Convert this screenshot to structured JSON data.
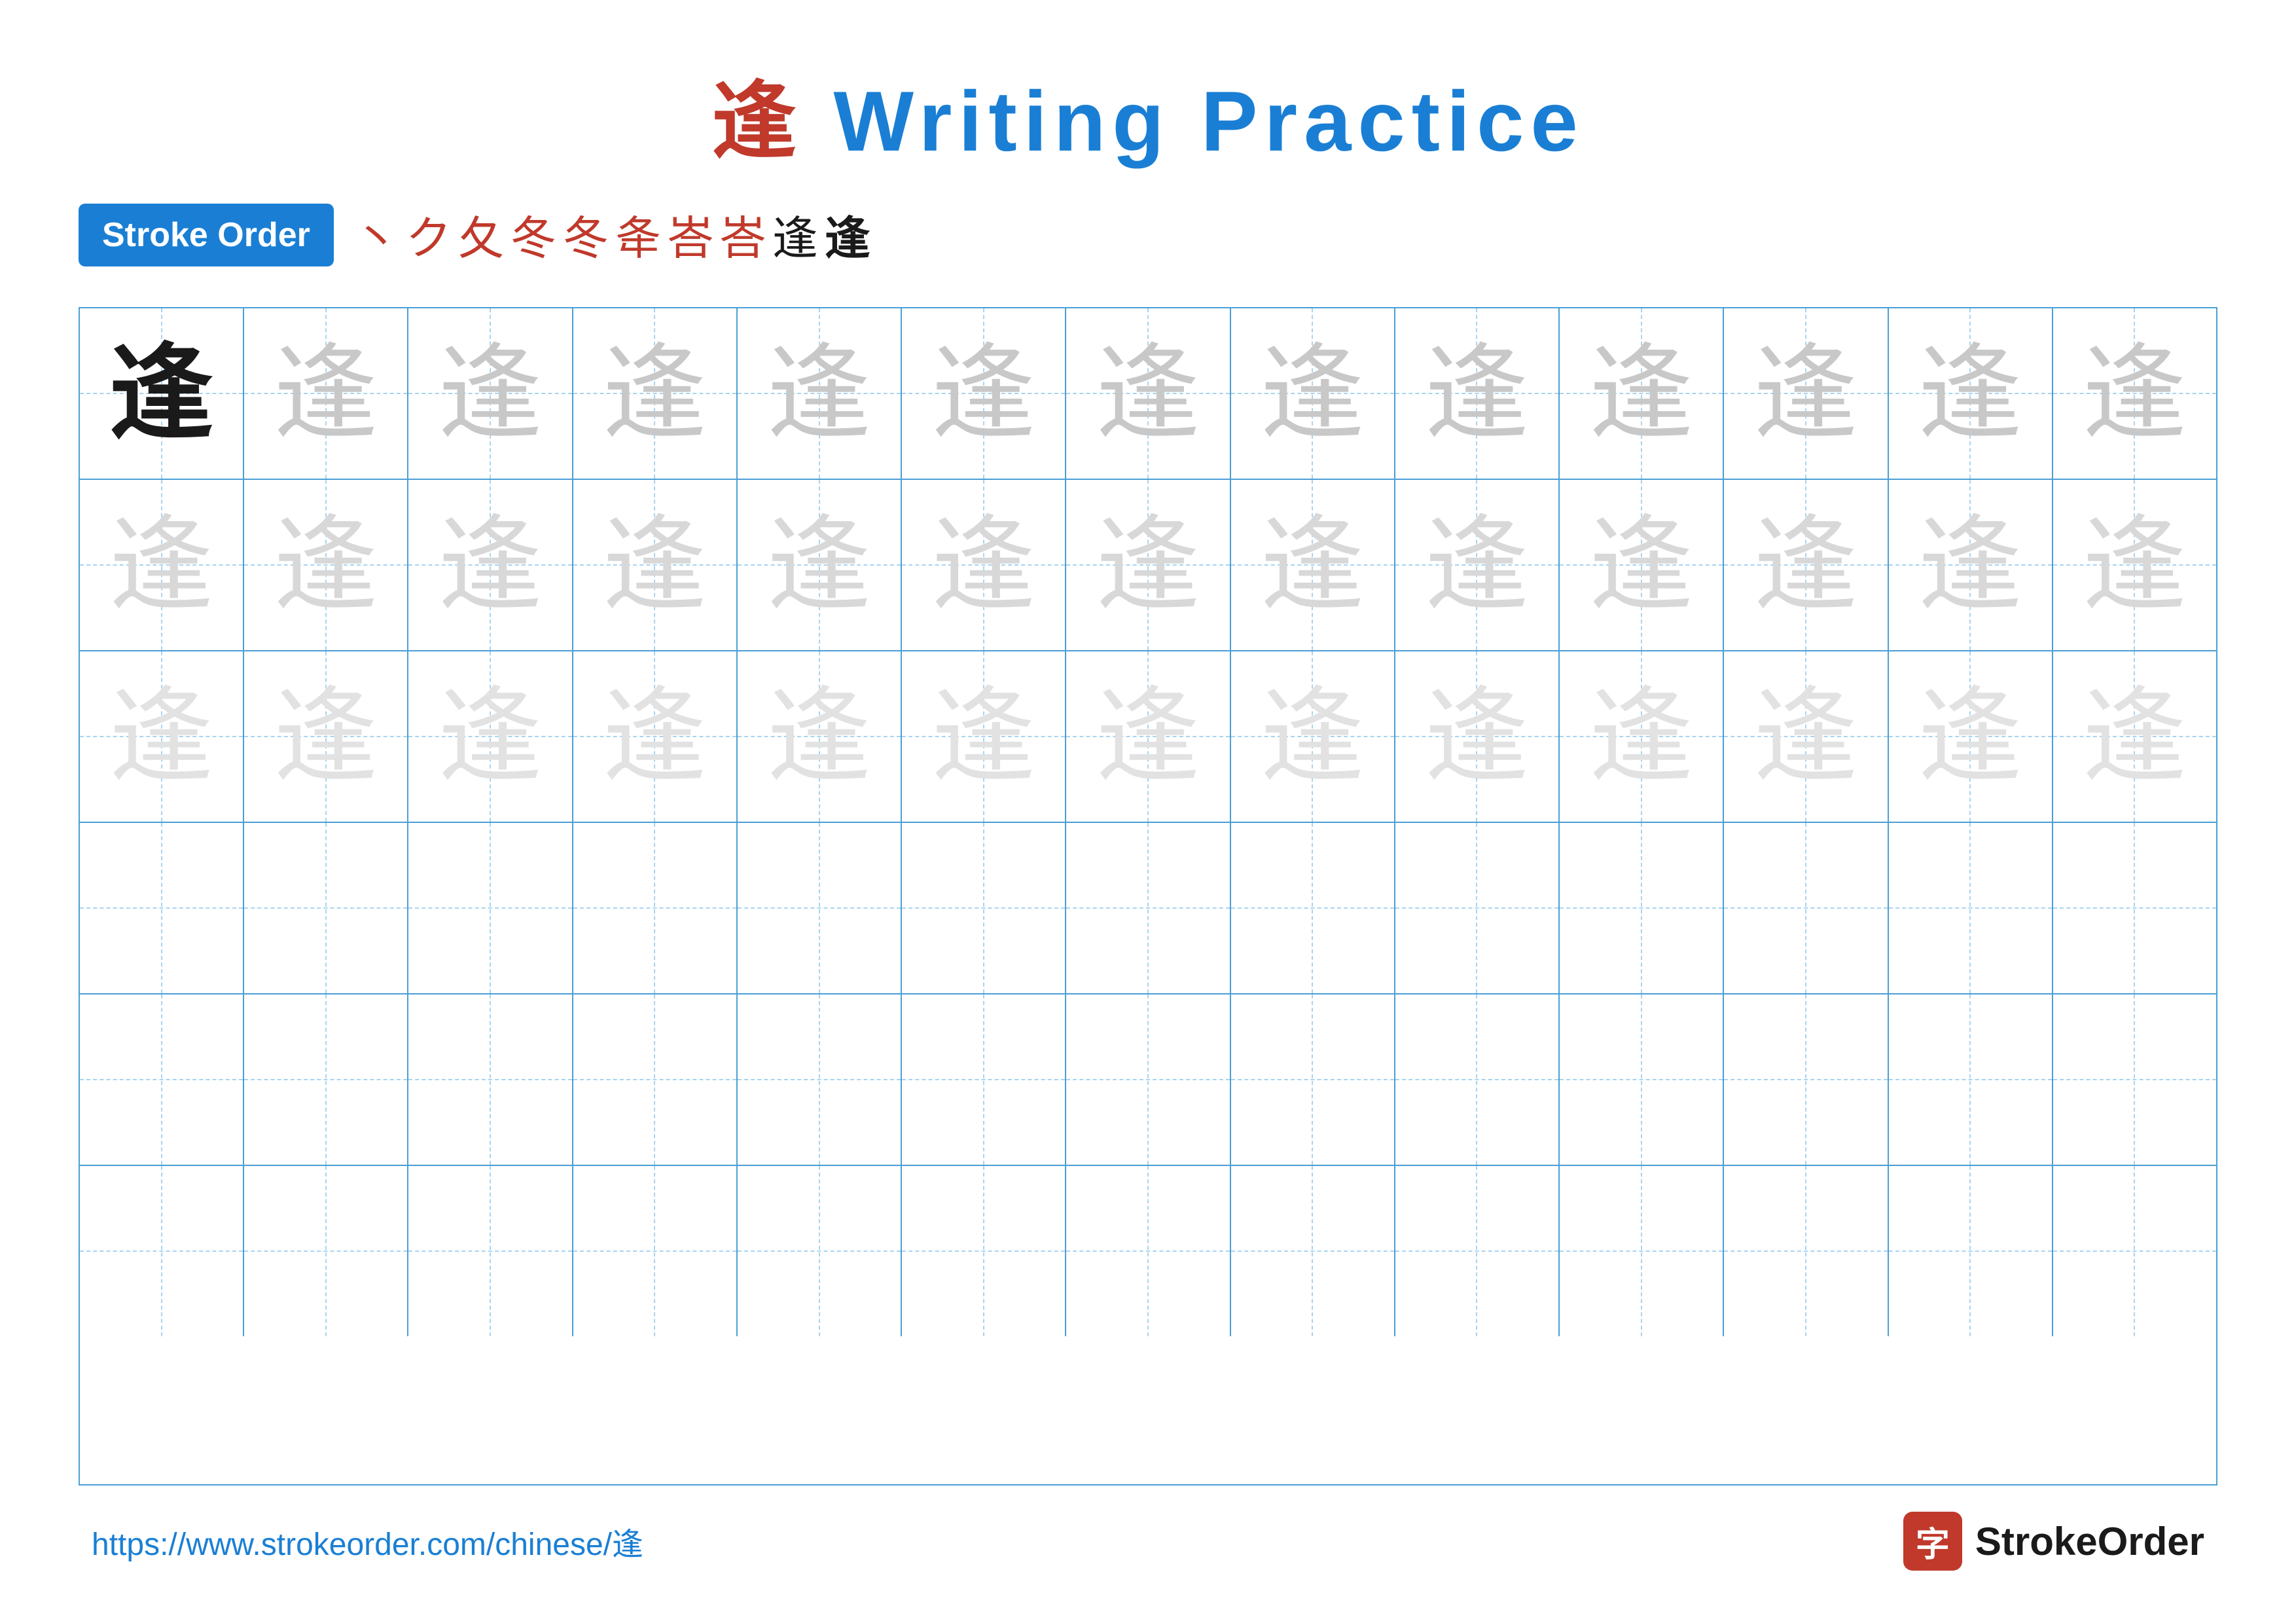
{
  "title": {
    "char": "逢",
    "rest": " Writing Practice"
  },
  "stroke_order": {
    "badge": "Stroke Order",
    "strokes": [
      "丶",
      "ク",
      "夂",
      "冬",
      "冬",
      "夅",
      "峇",
      "峇",
      "逢",
      "逢"
    ]
  },
  "grid": {
    "rows": 6,
    "cols": 13,
    "char": "逢",
    "row_types": [
      "dark_then_light1",
      "light2",
      "lighter",
      "empty",
      "empty",
      "empty"
    ]
  },
  "footer": {
    "url": "https://www.strokeorder.com/chinese/逢",
    "logo_char": "字",
    "logo_text": "StrokeOrder"
  }
}
